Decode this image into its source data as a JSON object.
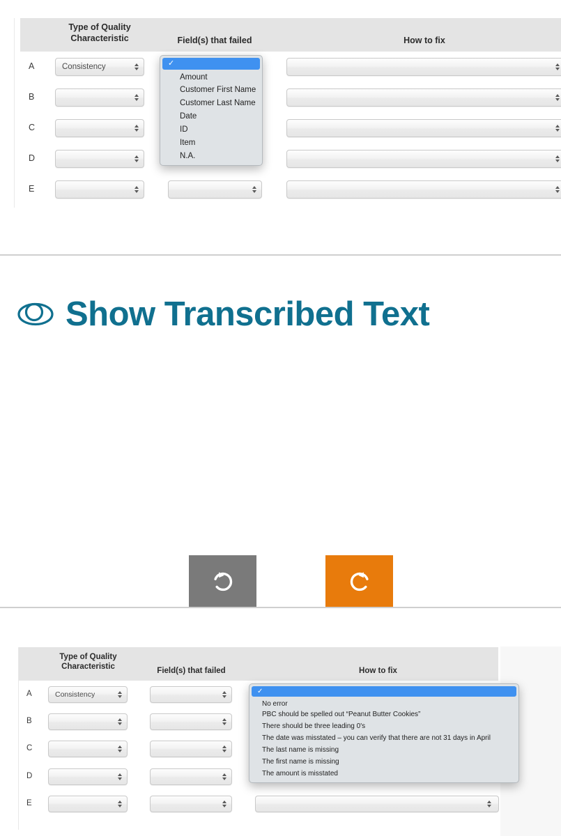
{
  "top_table": {
    "headers": {
      "col1_line1": "Type of Quality",
      "col1_line2": "Characteristic",
      "col2": "Field(s) that failed",
      "col3": "How to fix"
    },
    "rows": [
      {
        "label": "A",
        "quality": "Consistency",
        "field": "",
        "fix": ""
      },
      {
        "label": "B",
        "quality": "",
        "field": "",
        "fix": ""
      },
      {
        "label": "C",
        "quality": "",
        "field": "",
        "fix": ""
      },
      {
        "label": "D",
        "quality": "",
        "field": "",
        "fix": ""
      },
      {
        "label": "E",
        "quality": "",
        "field": "",
        "fix": ""
      }
    ],
    "open_dropdown": {
      "anchor_row": "A",
      "anchor_column": "Field(s) that failed",
      "selected_index": 0,
      "selected_label": "",
      "options": [
        "",
        "Amount",
        "Customer First Name",
        "Customer Last Name",
        "Date",
        "ID",
        "Item",
        "N.A."
      ]
    }
  },
  "show_transcribed": {
    "icon": "eye-icon",
    "label": "Show Transcribed Text",
    "color": "#10708f"
  },
  "controls": {
    "undo": {
      "label": "undo",
      "icon": "rotate-counterclockwise-icon",
      "color": "#7a7a7a"
    },
    "redo": {
      "label": "redo",
      "icon": "rotate-clockwise-icon",
      "color": "#e87b0c"
    }
  },
  "bottom_table": {
    "headers": {
      "col1_line1": "Type of Quality",
      "col1_line2": "Characteristic",
      "col2": "Field(s) that failed",
      "col3": "How to fix"
    },
    "rows": [
      {
        "label": "A",
        "quality": "Consistency",
        "field": "",
        "fix": ""
      },
      {
        "label": "B",
        "quality": "",
        "field": "",
        "fix": ""
      },
      {
        "label": "C",
        "quality": "",
        "field": "",
        "fix": ""
      },
      {
        "label": "D",
        "quality": "",
        "field": "",
        "fix": ""
      },
      {
        "label": "E",
        "quality": "",
        "field": "",
        "fix": ""
      }
    ],
    "open_dropdown": {
      "anchor_row": "A",
      "anchor_column": "How to fix",
      "selected_index": 0,
      "selected_label": "",
      "options": [
        "",
        "No error",
        "PBC should be spelled out “Peanut Butter Cookies”",
        "There should be three leading 0's",
        "The date was misstated – you can verify that there are not 31 days in April",
        "The last name is missing",
        "The first name is missing",
        "The amount is misstated"
      ]
    }
  }
}
